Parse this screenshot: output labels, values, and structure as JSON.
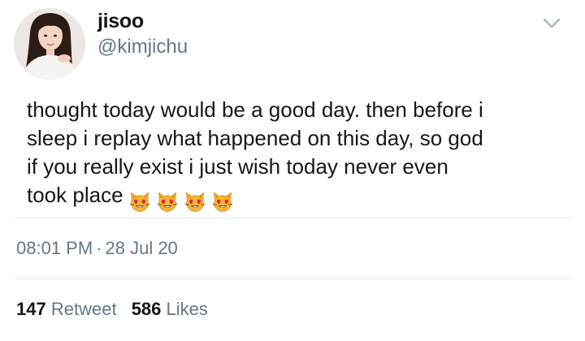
{
  "author": {
    "display_name": "jisoo",
    "handle": "@kimjichu",
    "avatar_icon": "profile-photo"
  },
  "tweet": {
    "lines": [
      "thought today would be a good day. then before i",
      "sleep i replay what happened on this day, so god",
      "if you really exist i just wish today never even",
      "took place"
    ],
    "emojis": [
      "heart-eyes-cat",
      "heart-eyes-cat",
      "heart-eyes-cat",
      "heart-eyes-cat"
    ]
  },
  "meta": {
    "time": "08:01 PM",
    "separator": "·",
    "date": "28 Jul 20"
  },
  "stats": {
    "retweets_count": "147",
    "retweets_label": "Retweet",
    "likes_count": "586",
    "likes_label": "Likes"
  },
  "colors": {
    "text_primary": "#14171a",
    "text_secondary": "#657786",
    "divider": "#e6ecf0",
    "caret": "#aab8c2"
  }
}
